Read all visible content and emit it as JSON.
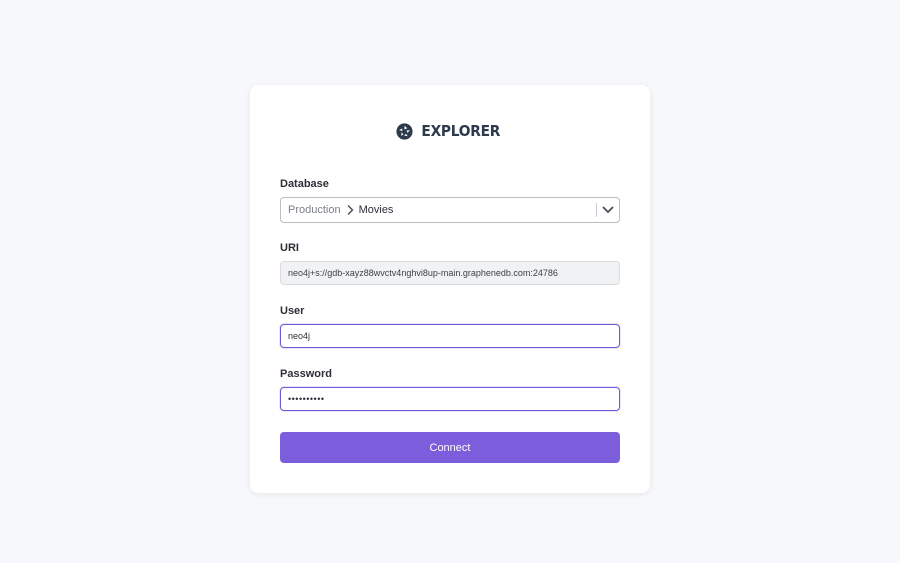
{
  "app": {
    "logo_text": "EXPLORER",
    "logo_icon": "aperture-icon"
  },
  "form": {
    "database": {
      "label": "Database",
      "parent": "Production",
      "current": "Movies"
    },
    "uri": {
      "label": "URI",
      "value": "neo4j+s://gdb-xayz88wvctv4nghvi8up-main.graphenedb.com:24786"
    },
    "user": {
      "label": "User",
      "value": "neo4j"
    },
    "password": {
      "label": "Password",
      "masked": "••••••••••"
    },
    "connect_label": "Connect"
  },
  "colors": {
    "accent": "#7c5ddc",
    "focus_border": "#6b5ad6",
    "background": "#f7f8fb",
    "logo": "#2c3a4b"
  }
}
